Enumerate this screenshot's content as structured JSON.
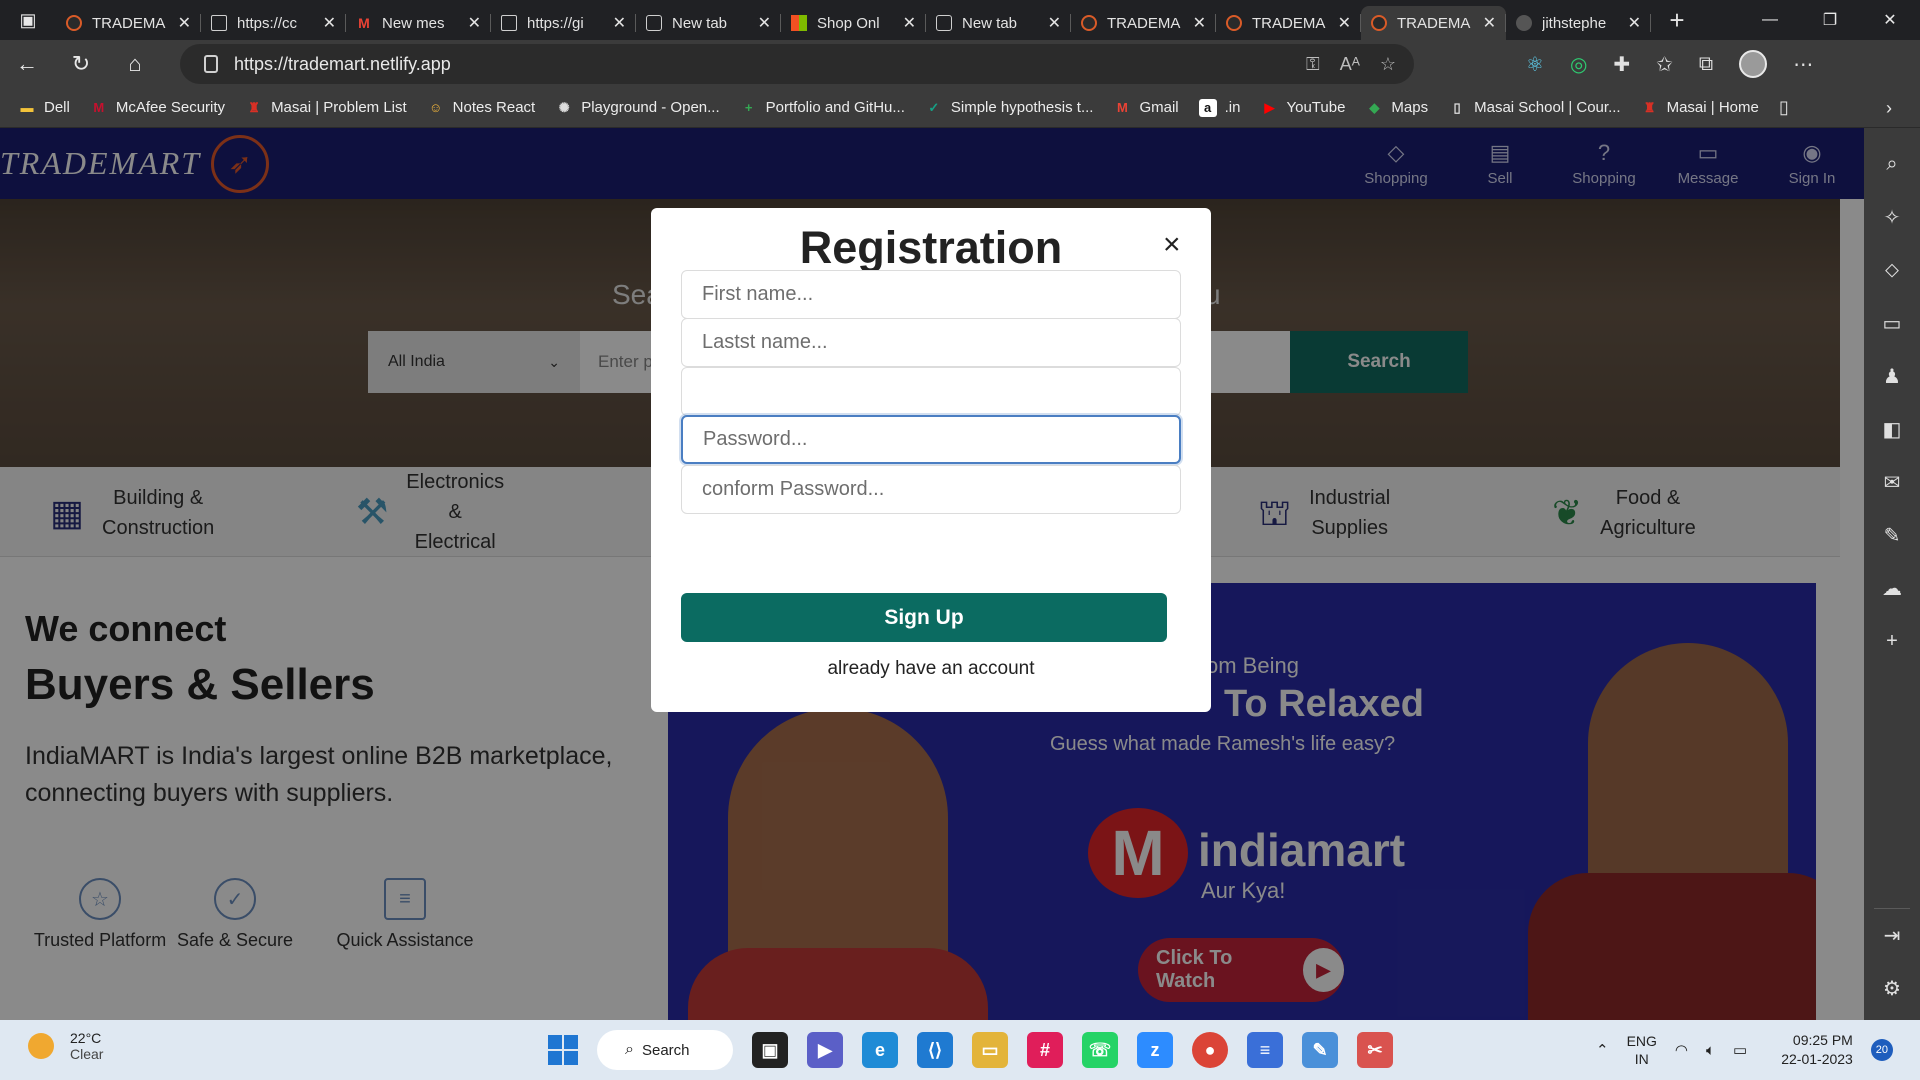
{
  "browser": {
    "tabs": [
      {
        "label": "TRADEMA",
        "favicon": "trademart-icon",
        "active": false
      },
      {
        "label": "https://cc",
        "favicon": "document-icon",
        "active": false
      },
      {
        "label": "New mes",
        "favicon": "gmail-icon",
        "active": false
      },
      {
        "label": "https://gi",
        "favicon": "document-icon",
        "active": false
      },
      {
        "label": "New tab",
        "favicon": "newtab-icon",
        "active": false
      },
      {
        "label": "Shop Onl",
        "favicon": "microsoft-icon",
        "active": false
      },
      {
        "label": "New tab",
        "favicon": "newtab-icon",
        "active": false
      },
      {
        "label": "TRADEMA",
        "favicon": "trademart-icon",
        "active": false
      },
      {
        "label": "TRADEMA",
        "favicon": "trademart-icon",
        "active": false
      },
      {
        "label": "TRADEMA",
        "favicon": "trademart-icon",
        "active": true
      },
      {
        "label": "jithstephe",
        "favicon": "github-icon",
        "active": false
      }
    ],
    "url": "https://trademart.netlify.app",
    "bookmarks": [
      {
        "label": "Dell",
        "icon": "folder-icon",
        "color": "#f3c33a"
      },
      {
        "label": "McAfee Security",
        "icon": "mcafee-icon",
        "color": "#c8102e"
      },
      {
        "label": "Masai | Problem List",
        "icon": "masai-icon",
        "color": "#d93025"
      },
      {
        "label": "Notes React",
        "icon": "emoji-icon",
        "color": "#f5b73b"
      },
      {
        "label": "Playground - Open...",
        "icon": "openai-icon",
        "color": "#dddddd"
      },
      {
        "label": "Portfolio and GitHu...",
        "icon": "plus-icon",
        "color": "#34a853"
      },
      {
        "label": "Simple hypothesis t...",
        "icon": "check-icon",
        "color": "#16a085"
      },
      {
        "label": "Gmail",
        "icon": "gmail-icon",
        "color": "#ea4335"
      },
      {
        "label": ".in",
        "icon": "amazon-icon",
        "color": "#ffffff"
      },
      {
        "label": "YouTube",
        "icon": "youtube-icon",
        "color": "#ff0000"
      },
      {
        "label": "Maps",
        "icon": "maps-icon",
        "color": "#34a853"
      },
      {
        "label": "Masai School | Cour...",
        "icon": "document-icon",
        "color": "#dddddd"
      },
      {
        "label": "Masai | Home",
        "icon": "masai-icon",
        "color": "#d93025"
      }
    ]
  },
  "site": {
    "logo_text": "TRADEMART",
    "nav": [
      {
        "label": "Shopping",
        "icon": "tag-icon"
      },
      {
        "label": "Sell",
        "icon": "store-icon"
      },
      {
        "label": "Shopping",
        "icon": "help-icon"
      },
      {
        "label": "Message",
        "icon": "message-icon"
      },
      {
        "label": "Sign In",
        "icon": "user-icon"
      }
    ],
    "hero": {
      "title_left": "Sea",
      "title_right": "u",
      "location": "All India",
      "search_placeholder": "Enter p",
      "search_button": "Search"
    },
    "categories": [
      {
        "line1": "Building &",
        "line2": "Construction",
        "line3": ""
      },
      {
        "line1": "Electronics",
        "line2": "&",
        "line3": "Electrical"
      },
      {
        "line1": "Industrial",
        "line2": "Supplies",
        "line3": ""
      },
      {
        "line1": "Food &",
        "line2": "Agriculture",
        "line3": ""
      }
    ],
    "connect": {
      "line1": "We connect",
      "line2": "Buyers & Sellers",
      "desc": "IndiaMART is India's largest online B2B marketplace, connecting buyers with suppliers."
    },
    "features": [
      {
        "label": "Trusted Platform",
        "icon": "star-badge-icon"
      },
      {
        "label": "Safe & Secure",
        "icon": "shield-check-icon"
      },
      {
        "label": "Quick Assistance",
        "icon": "chat-icon"
      }
    ],
    "banner": {
      "line1": "om Being",
      "line2": "To Relaxed",
      "line3": "Guess what made Ramesh's life easy?",
      "brand": "indiamart",
      "tagline": "Aur Kya!",
      "cta": "Click To Watch"
    }
  },
  "modal": {
    "title": "Registration",
    "close": "×",
    "first_name_placeholder": "First name...",
    "last_name_placeholder": "Lastst name...",
    "email_placeholder": "",
    "password_placeholder": "Password...",
    "confirm_placeholder": "conform Password...",
    "submit": "Sign Up",
    "login_link": "already have an account"
  },
  "taskbar": {
    "temperature": "22°C",
    "condition": "Clear",
    "search": "Search",
    "lang_line1": "ENG",
    "lang_line2": "IN",
    "time": "09:25 PM",
    "date": "22-01-2023",
    "notifications": "20"
  }
}
